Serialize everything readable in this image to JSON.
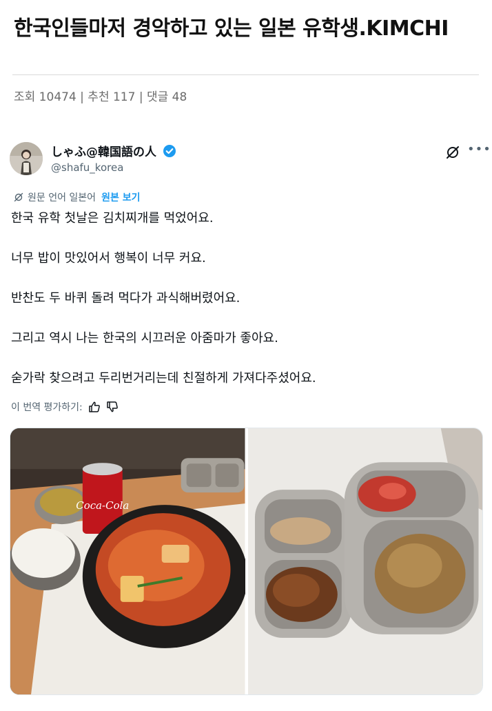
{
  "post": {
    "title": "한국인들마저 경악하고 있는 일본 유학생.KIMCHI",
    "meta": "조회 10474 | 추천 117 | 댓글 48"
  },
  "tweet": {
    "display_name": "しゃふ@韓国語の人",
    "handle": "@shafu_korea",
    "translate_label": "원문 언어 일본어",
    "show_original": "원본 보기",
    "paragraphs": [
      "한국 유학 첫날은 김치찌개를 먹었어요.",
      "너무 밥이 맛있어서 행복이 너무 커요.",
      "반찬도 두 바퀴 돌려 먹다가 과식해버렸어요.",
      "그리고 역시 나는 한국의 시끄러운 아줌마가 좋아요.",
      "숟가락 찾으려고 두리번거리는데 친절하게 가져다주셨어요."
    ],
    "rate_label": "이 번역 평가하기:",
    "media": [
      {
        "icon": "kimchi-stew-photo",
        "can_label": "Coca-Cola"
      },
      {
        "icon": "banchan-tray-photo"
      }
    ]
  },
  "colors": {
    "accent": "#1d9bf0",
    "text": "#0f1419",
    "muted": "#536471"
  }
}
